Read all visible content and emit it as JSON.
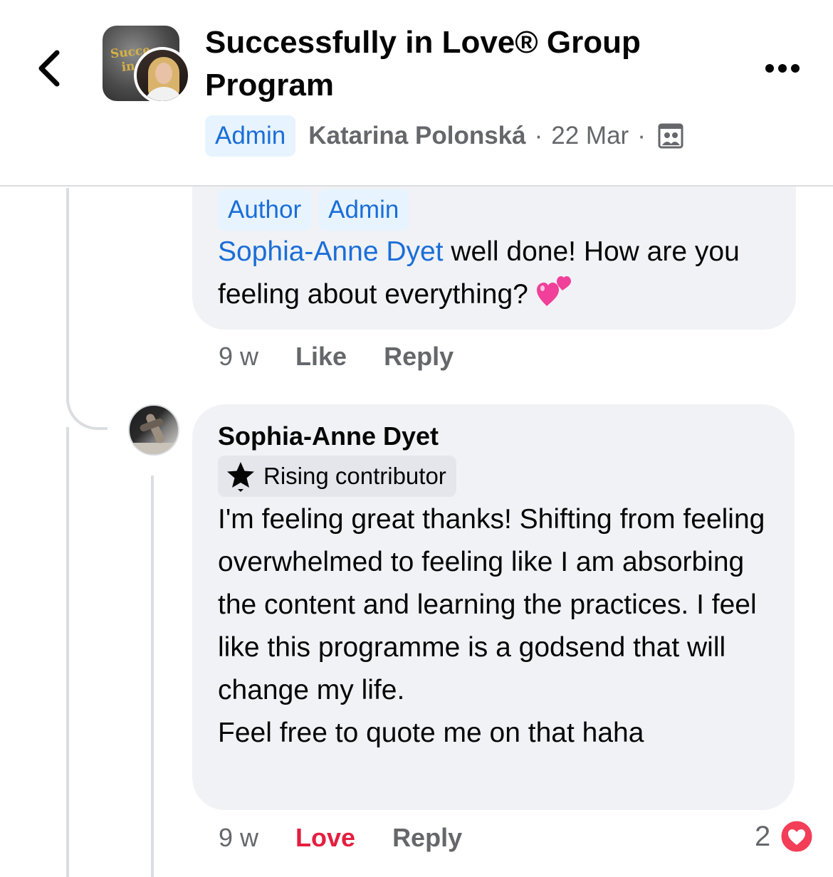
{
  "header": {
    "group_title": "Successfully in Love® Group Program",
    "group_logo_text": "Succe in",
    "badge": "Admin",
    "author": "Katarina Polonská",
    "separator": "·",
    "date": "22 Mar",
    "separator2": "·",
    "icons": {
      "back": "chevron-left-icon",
      "more": "more-dots-icon",
      "audience": "group-members-icon"
    }
  },
  "comments": [
    {
      "badges": [
        "Author",
        "Admin"
      ],
      "mention": "Sophia-Anne Dyet",
      "text": " well done! How are you feeling about everything?",
      "emoji": "two-hearts-emoji",
      "time": "9 w",
      "actions": [
        "Like",
        "Reply"
      ]
    },
    {
      "name": "Sophia-Anne Dyet",
      "badge": "Rising contributor",
      "badge_icon": "star-icon",
      "text": "I'm feeling great thanks! Shifting from feeling overwhelmed to feeling like I am absorbing the content and learning the practices. I feel like this programme is a godsend that will change my life.\nFeel free to quote me on that haha",
      "time": "9 w",
      "actions": [
        "Love",
        "Reply"
      ],
      "reaction_count": "2",
      "reaction_icon": "love-reaction-icon"
    }
  ],
  "colors": {
    "link_blue": "#1a6ed8",
    "badge_bg": "#e7f3ff",
    "bubble_bg": "#f0f2f5",
    "secondary_text": "#65676b",
    "love_red": "#e41e3f"
  }
}
